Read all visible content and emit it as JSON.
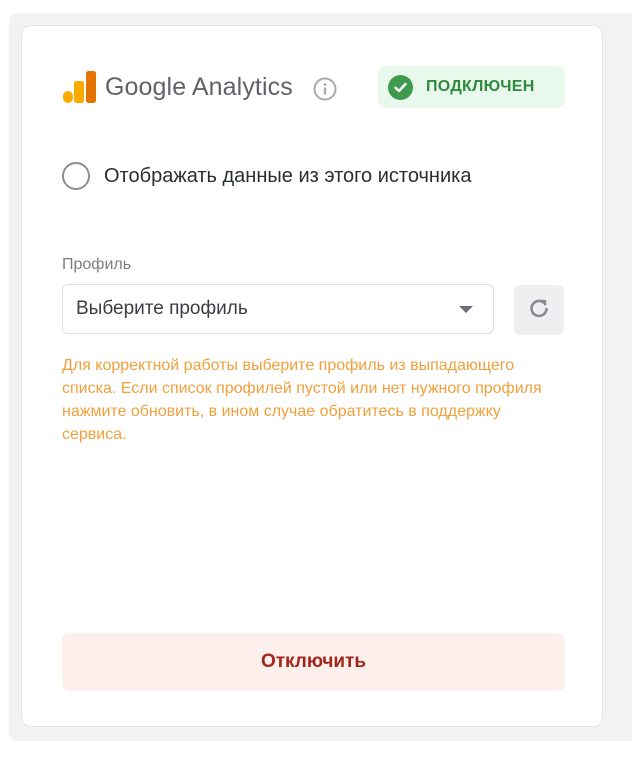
{
  "integration": {
    "brand_name": "Google Analytics",
    "logo_icon": "google-analytics-logo",
    "info_icon": "info-icon",
    "status_label": "ПОДКЛЮЧЕН",
    "status_icon": "check-circle-icon"
  },
  "display_toggle": {
    "label": "Отображать данные из этого источника",
    "checked": false
  },
  "profile": {
    "label": "Профиль",
    "selected_value": "Выберите профиль",
    "refresh_icon": "refresh-icon",
    "hint": "Для корректной работы выберите профиль из выпадающего списка. Если список профилей пустой или нет нужного профиля нажмите обновить, в ином случае обратитесь в поддержку сервиса."
  },
  "actions": {
    "disconnect_label": "Отключить"
  },
  "colors": {
    "success_bg": "#e9f8ec",
    "success_fg": "#2f8a3e",
    "warning": "#f0a03c",
    "danger_bg": "#fcefec",
    "danger_fg": "#a3261b",
    "ga_orange": "#f9ab00",
    "ga_dark_orange": "#e37400"
  }
}
